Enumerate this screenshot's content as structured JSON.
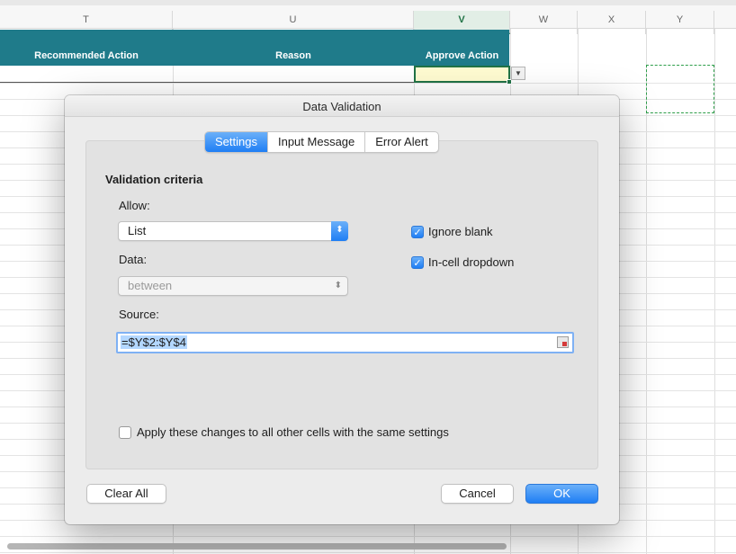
{
  "spreadsheet": {
    "columns": [
      {
        "letter": "T",
        "active": false
      },
      {
        "letter": "U",
        "active": false
      },
      {
        "letter": "V",
        "active": true
      },
      {
        "letter": "W",
        "active": false
      },
      {
        "letter": "X",
        "active": false
      },
      {
        "letter": "Y",
        "active": false
      }
    ],
    "header_cells": [
      "Recommended Action",
      "Reason",
      "Approve Action"
    ],
    "header_fill": "#1f7b8a",
    "selection_color": "#217346"
  },
  "dialog": {
    "title": "Data Validation",
    "tabs": [
      {
        "label": "Settings",
        "selected": true
      },
      {
        "label": "Input Message",
        "selected": false
      },
      {
        "label": "Error Alert",
        "selected": false
      }
    ],
    "section_title": "Validation criteria",
    "allow_label": "Allow:",
    "allow_value": "List",
    "data_label": "Data:",
    "data_value": "between",
    "ignore_blank_label": "Ignore blank",
    "ignore_blank_checked": true,
    "in_cell_dropdown_label": "In-cell dropdown",
    "in_cell_dropdown_checked": true,
    "source_label": "Source:",
    "source_value": "=$Y$2:$Y$4",
    "apply_all_label": "Apply these changes to all other cells with the same settings",
    "apply_all_checked": false,
    "clear_all_button": "Clear All",
    "cancel_button": "Cancel",
    "ok_button": "OK",
    "accent_color": "#1f7ef4"
  },
  "icons": {
    "select_stepper": "chevron-up-down-icon",
    "checkmark": "checkmark-icon",
    "range_reference": "range-reference-icon",
    "cell_dropdown": "dropdown-arrow-icon"
  }
}
